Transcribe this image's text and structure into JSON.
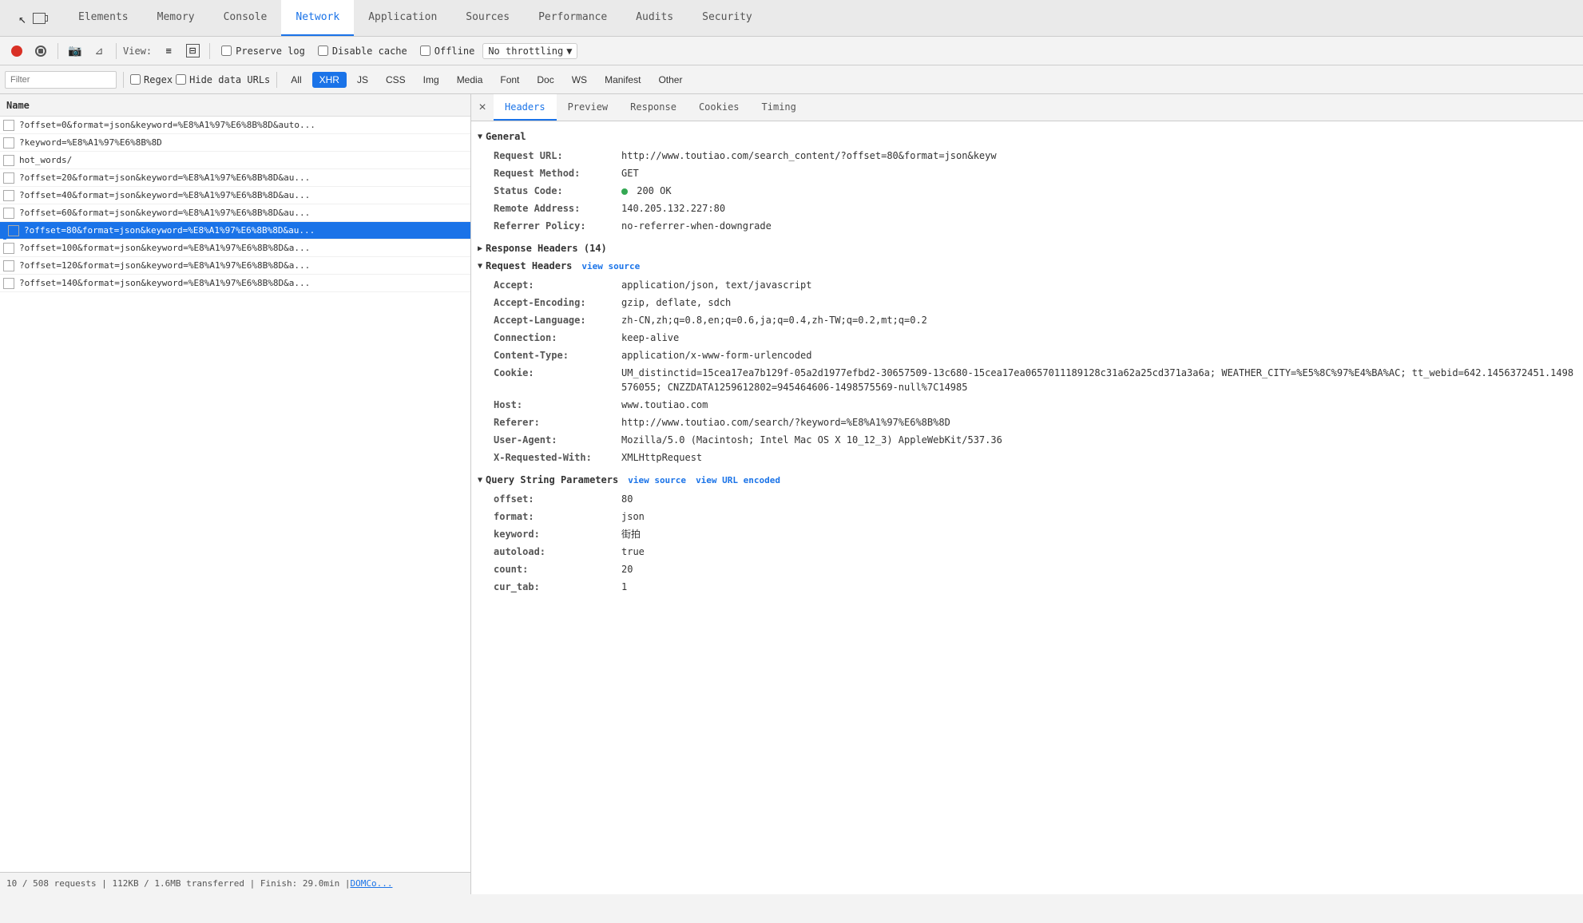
{
  "nav": {
    "tabs": [
      {
        "id": "elements",
        "label": "Elements",
        "active": false
      },
      {
        "id": "memory",
        "label": "Memory",
        "active": false
      },
      {
        "id": "console",
        "label": "Console",
        "active": false
      },
      {
        "id": "network",
        "label": "Network",
        "active": true
      },
      {
        "id": "application",
        "label": "Application",
        "active": false
      },
      {
        "id": "sources",
        "label": "Sources",
        "active": false
      },
      {
        "id": "performance",
        "label": "Performance",
        "active": false
      },
      {
        "id": "audits",
        "label": "Audits",
        "active": false
      },
      {
        "id": "security",
        "label": "Security",
        "active": false
      }
    ]
  },
  "toolbar": {
    "view_label": "View:",
    "preserve_log_label": "Preserve log",
    "disable_cache_label": "Disable cache",
    "offline_label": "Offline",
    "throttle_label": "No throttling"
  },
  "filter": {
    "placeholder": "Filter",
    "regex_label": "Regex",
    "hide_data_urls_label": "Hide data URLs",
    "types": [
      "All",
      "XHR",
      "JS",
      "CSS",
      "Img",
      "Media",
      "Font",
      "Doc",
      "WS",
      "Manifest",
      "Other"
    ],
    "active_type": "XHR"
  },
  "request_list": {
    "column_name": "Name",
    "items": [
      {
        "url": "?offset=0&format=json&keyword=%E8%A1%97%E6%8B%8D&auto...",
        "selected": false
      },
      {
        "url": "?keyword=%E8%A1%97%E6%8B%8D",
        "selected": false
      },
      {
        "url": "hot_words/",
        "selected": false
      },
      {
        "url": "?offset=20&format=json&keyword=%E8%A1%97%E6%8B%8D&au...",
        "selected": false
      },
      {
        "url": "?offset=40&format=json&keyword=%E8%A1%97%E6%8B%8D&au...",
        "selected": false
      },
      {
        "url": "?offset=60&format=json&keyword=%E8%A1%97%E6%8B%8D&au...",
        "selected": false
      },
      {
        "url": "?offset=80&format=json&keyword=%E8%A1%97%E6%8B%8D&au...",
        "selected": true
      },
      {
        "url": "?offset=100&format=json&keyword=%E8%A1%97%E6%8B%8D&a...",
        "selected": false
      },
      {
        "url": "?offset=120&format=json&keyword=%E8%A1%97%E6%8B%8D&a...",
        "selected": false
      },
      {
        "url": "?offset=140&format=json&keyword=%E8%A1%97%E6%8B%8D&a...",
        "selected": false
      }
    ]
  },
  "status_bar": {
    "text": "10 / 508 requests | 112KB / 1.6MB transferred | Finish: 29.0min | ",
    "link_text": "DOMCo..."
  },
  "detail_tabs": {
    "tabs": [
      "Headers",
      "Preview",
      "Response",
      "Cookies",
      "Timing"
    ],
    "active": "Headers"
  },
  "headers": {
    "general": {
      "title": "General",
      "request_url_key": "Request URL:",
      "request_url_value": "http://www.toutiao.com/search_content/?offset=80&format=json&keyw",
      "method_key": "Request Method:",
      "method_value": "GET",
      "status_key": "Status Code:",
      "status_value": "200  OK",
      "remote_key": "Remote Address:",
      "remote_value": "140.205.132.227:80",
      "referrer_key": "Referrer Policy:",
      "referrer_value": "no-referrer-when-downgrade"
    },
    "response_headers": {
      "title": "Response Headers (14)"
    },
    "request_headers": {
      "title": "Request Headers",
      "view_source": "view source",
      "rows": [
        {
          "key": "Accept:",
          "value": "application/json, text/javascript"
        },
        {
          "key": "Accept-Encoding:",
          "value": "gzip, deflate, sdch"
        },
        {
          "key": "Accept-Language:",
          "value": "zh-CN,zh;q=0.8,en;q=0.6,ja;q=0.4,zh-TW;q=0.2,mt;q=0.2"
        },
        {
          "key": "Connection:",
          "value": "keep-alive"
        },
        {
          "key": "Content-Type:",
          "value": "application/x-www-form-urlencoded"
        },
        {
          "key": "Cookie:",
          "value": "UM_distinctid=15cea17ea7b129f-05a2d1977efbd2-30657509-13c680-15cea17ea0657011189128c31a62a25cd371a3a6a; WEATHER_CITY=%E5%8C%97%E4%BA%AC; tt_webid=642.1456372451.1498576055; CNZZDATA1259612802=945464606-1498575569-null%7C14985"
        },
        {
          "key": "Host:",
          "value": "www.toutiao.com"
        },
        {
          "key": "Referer:",
          "value": "http://www.toutiao.com/search/?keyword=%E8%A1%97%E6%8B%8D"
        },
        {
          "key": "User-Agent:",
          "value": "Mozilla/5.0 (Macintosh; Intel Mac OS X 10_12_3) AppleWebKit/537.36"
        },
        {
          "key": "X-Requested-With:",
          "value": "XMLHttpRequest"
        }
      ]
    },
    "query_string": {
      "title": "Query String Parameters",
      "view_source": "view source",
      "view_url_encoded": "view URL encoded",
      "rows": [
        {
          "key": "offset:",
          "value": "80"
        },
        {
          "key": "format:",
          "value": "json"
        },
        {
          "key": "keyword:",
          "value": "街拍"
        },
        {
          "key": "autoload:",
          "value": "true"
        },
        {
          "key": "count:",
          "value": "20"
        },
        {
          "key": "cur_tab:",
          "value": "1"
        }
      ]
    }
  }
}
